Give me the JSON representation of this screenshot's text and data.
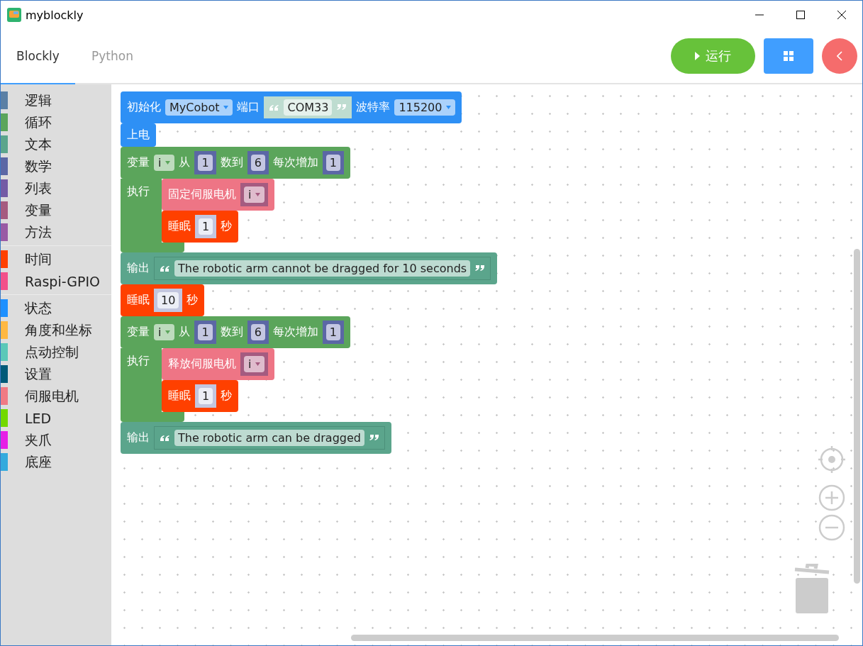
{
  "window": {
    "title": "myblockly"
  },
  "tabs": [
    {
      "label": "Blockly",
      "selected": true
    },
    {
      "label": "Python",
      "selected": false
    }
  ],
  "run_button": {
    "label": "运行"
  },
  "category_groups": [
    [
      {
        "label": "逻辑",
        "color": "#5b80a5"
      },
      {
        "label": "循环",
        "color": "#5ba55b"
      },
      {
        "label": "文本",
        "color": "#5ba58c"
      },
      {
        "label": "数学",
        "color": "#5b67a5"
      },
      {
        "label": "列表",
        "color": "#745ba5"
      },
      {
        "label": "变量",
        "color": "#a55b80"
      },
      {
        "label": "方法",
        "color": "#995ba5"
      }
    ],
    [
      {
        "label": "时间",
        "color": "#ff4000"
      },
      {
        "label": "Raspi-GPIO",
        "color": "#f2508a"
      }
    ],
    [
      {
        "label": "状态",
        "color": "#1e90ff"
      },
      {
        "label": "角度和坐标",
        "color": "#ffb842"
      },
      {
        "label": "点动控制",
        "color": "#5bc8b8"
      },
      {
        "label": "设置",
        "color": "#005a78"
      },
      {
        "label": "伺服电机",
        "color": "#f07a84"
      },
      {
        "label": "LED",
        "color": "#72d900"
      },
      {
        "label": "夹爪",
        "color": "#e61ee6"
      },
      {
        "label": "底座",
        "color": "#33aadd"
      }
    ]
  ],
  "blocks": [
    {
      "kind": "row",
      "color": "#2e90f5",
      "fields": [
        {
          "kind": "label",
          "text": "初始化"
        },
        {
          "kind": "dropdown",
          "text": "MyCobot"
        },
        {
          "kind": "label",
          "text": "端口"
        },
        {
          "kind": "string",
          "text": "COM33"
        },
        {
          "kind": "label",
          "text": "波特率"
        },
        {
          "kind": "dropdown",
          "text": "115200"
        }
      ]
    },
    {
      "kind": "row",
      "color": "#2e90f5",
      "fields": [
        {
          "kind": "label",
          "text": "上电"
        }
      ]
    },
    {
      "kind": "loop",
      "color": "#5ba55b",
      "do_label": "执行",
      "fields": [
        {
          "kind": "label",
          "text": "变量"
        },
        {
          "kind": "dropdown",
          "text": "i"
        },
        {
          "kind": "label",
          "text": "从"
        },
        {
          "kind": "number",
          "text": "1"
        },
        {
          "kind": "label",
          "text": "数到"
        },
        {
          "kind": "number",
          "text": "6"
        },
        {
          "kind": "label",
          "text": "每次增加"
        },
        {
          "kind": "number",
          "text": "1"
        }
      ],
      "children": [
        {
          "kind": "row",
          "color": "#ee7585",
          "fields": [
            {
              "kind": "label",
              "text": "固定伺服电机"
            },
            {
              "kind": "variable",
              "text": "i"
            }
          ]
        },
        {
          "kind": "row",
          "color": "#ff4000",
          "fields": [
            {
              "kind": "label",
              "text": "睡眠"
            },
            {
              "kind": "shadow_number",
              "text": "1"
            },
            {
              "kind": "label",
              "text": "秒"
            }
          ]
        }
      ]
    },
    {
      "kind": "row",
      "color": "#5ba58c",
      "fields": [
        {
          "kind": "label",
          "text": "输出"
        },
        {
          "kind": "string",
          "text": "The robotic arm cannot be dragged for 10 seconds"
        }
      ]
    },
    {
      "kind": "row",
      "color": "#ff4000",
      "fields": [
        {
          "kind": "label",
          "text": "睡眠"
        },
        {
          "kind": "shadow_number",
          "text": "10"
        },
        {
          "kind": "label",
          "text": "秒"
        }
      ]
    },
    {
      "kind": "loop",
      "color": "#5ba55b",
      "do_label": "执行",
      "fields": [
        {
          "kind": "label",
          "text": "变量"
        },
        {
          "kind": "dropdown",
          "text": "i"
        },
        {
          "kind": "label",
          "text": "从"
        },
        {
          "kind": "number",
          "text": "1"
        },
        {
          "kind": "label",
          "text": "数到"
        },
        {
          "kind": "number",
          "text": "6"
        },
        {
          "kind": "label",
          "text": "每次增加"
        },
        {
          "kind": "number",
          "text": "1"
        }
      ],
      "children": [
        {
          "kind": "row",
          "color": "#ee7585",
          "fields": [
            {
              "kind": "label",
              "text": "释放伺服电机"
            },
            {
              "kind": "variable",
              "text": "i"
            }
          ]
        },
        {
          "kind": "row",
          "color": "#ff4000",
          "fields": [
            {
              "kind": "label",
              "text": "睡眠"
            },
            {
              "kind": "shadow_number",
              "text": "1"
            },
            {
              "kind": "label",
              "text": "秒"
            }
          ]
        }
      ]
    },
    {
      "kind": "row",
      "color": "#5ba58c",
      "fields": [
        {
          "kind": "label",
          "text": "输出"
        },
        {
          "kind": "string",
          "text": "The robotic arm can be dragged"
        }
      ]
    }
  ]
}
